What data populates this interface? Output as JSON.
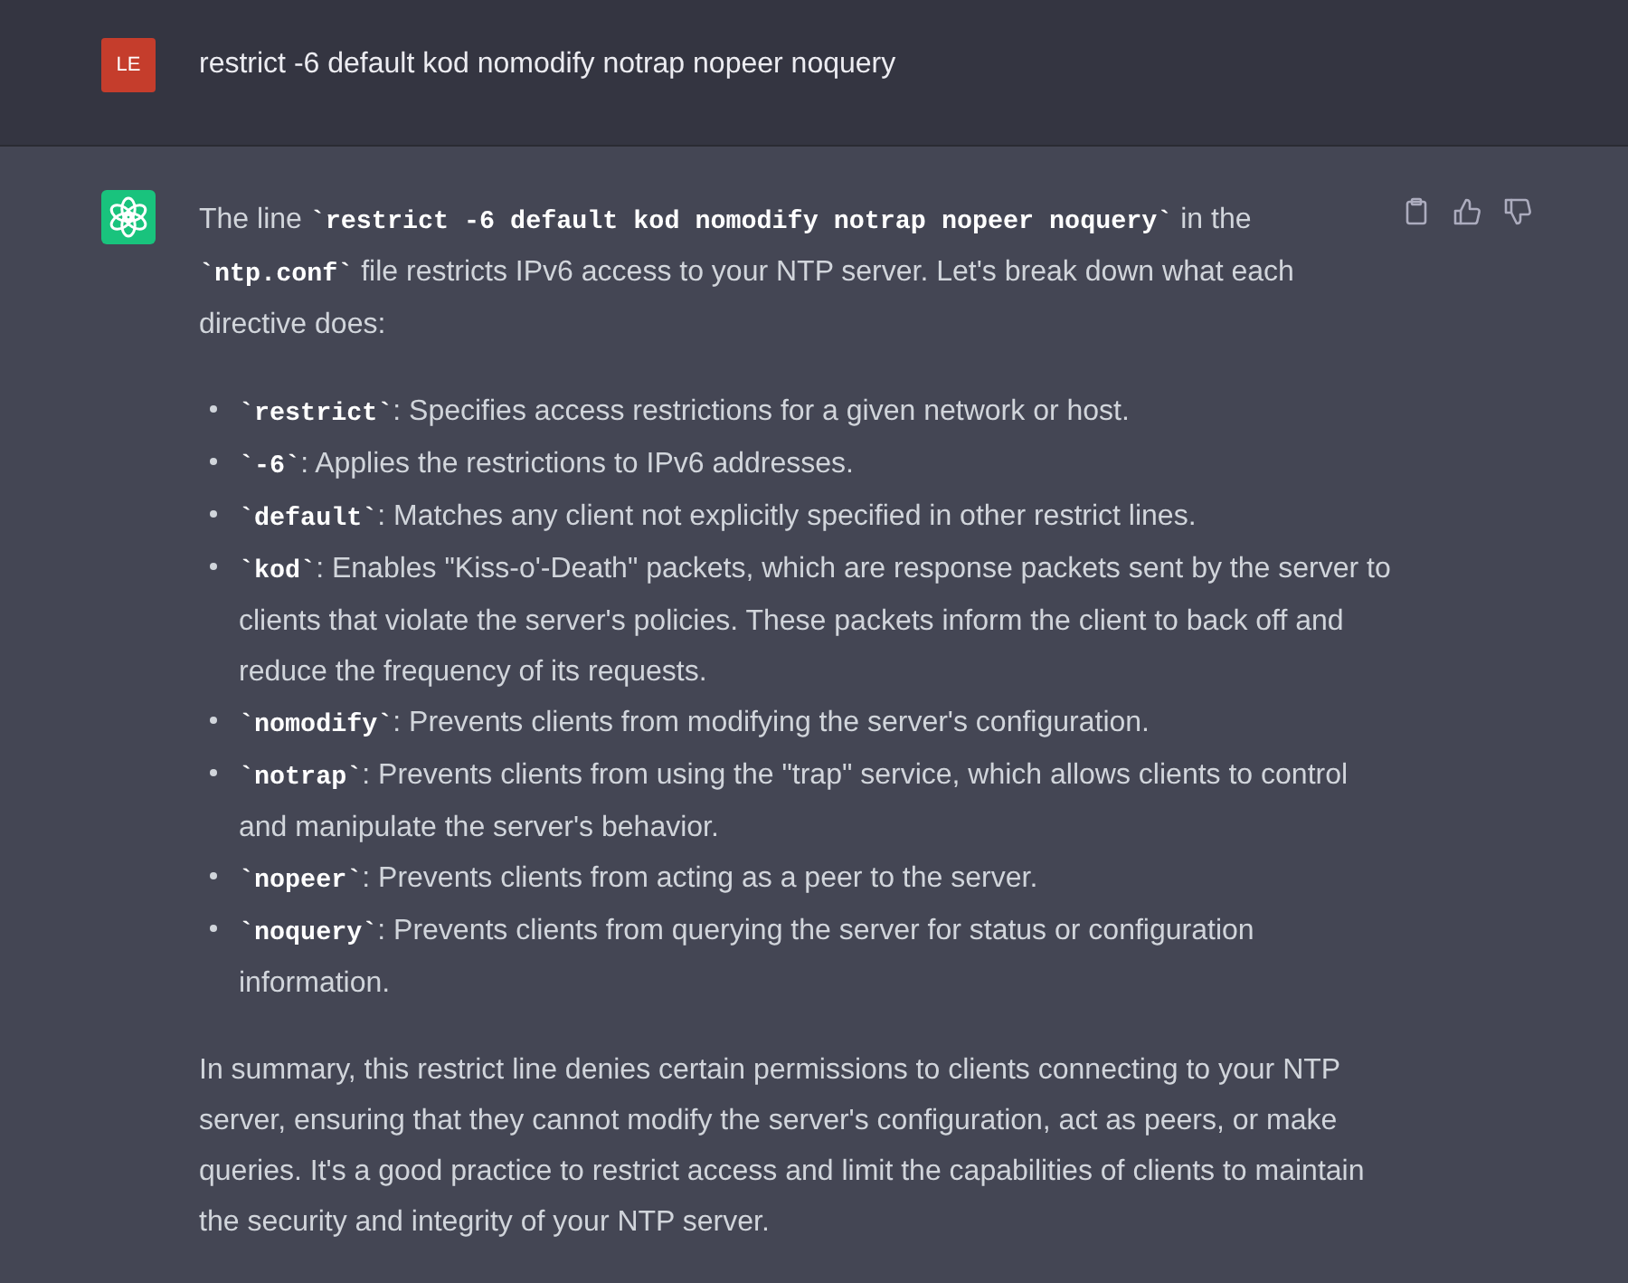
{
  "user_message": {
    "avatar": "LE",
    "text": "restrict -6 default kod nomodify notrap nopeer noquery"
  },
  "assistant_message": {
    "intro": "The line **`restrict -6 default kod nomodify notrap nopeer noquery`** in the **`ntp.conf`** file restricts IPv6 access to your NTP server. Let's break down what each directive does:",
    "bullets": [
      "**`restrict`**: Specifies access restrictions for a given network or host.",
      "**`-6`**: Applies the restrictions to IPv6 addresses.",
      "**`default`**: Matches any client not explicitly specified in other restrict lines.",
      "**`kod`**: Enables \"Kiss-o'-Death\" packets, which are response packets sent by the server to clients that violate the server's policies. These packets inform the client to back off and reduce the frequency of its requests.",
      "**`nomodify`**: Prevents clients from modifying the server's configuration.",
      "**`notrap`**: Prevents clients from using the \"trap\" service, which allows clients to control and manipulate the server's behavior.",
      "**`nopeer`**: Prevents clients from acting as a peer to the server.",
      "**`noquery`**: Prevents clients from querying the server for status or configuration information."
    ],
    "summary": "In summary, this restrict line denies certain permissions to clients connecting to your NTP server, ensuring that they cannot modify the server's configuration, act as peers, or make queries. It's a good practice to restrict access and limit the capabilities of clients to maintain the security and integrity of your NTP server."
  }
}
